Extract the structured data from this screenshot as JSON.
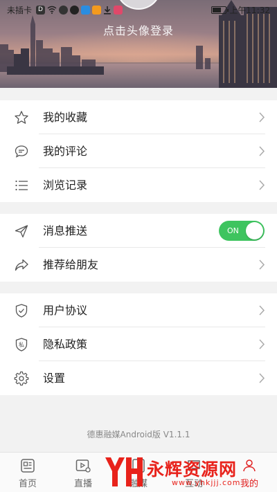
{
  "status_bar": {
    "carrier": "未插卡",
    "time": "上午11:32"
  },
  "header": {
    "login_prompt": "点击头像登录"
  },
  "sections": [
    {
      "items": [
        {
          "label": "我的收藏",
          "icon": "star-icon"
        },
        {
          "label": "我的评论",
          "icon": "comment-icon"
        },
        {
          "label": "浏览记录",
          "icon": "list-icon"
        }
      ]
    },
    {
      "items": [
        {
          "label": "消息推送",
          "icon": "send-icon",
          "toggle": "ON"
        },
        {
          "label": "推荐给朋友",
          "icon": "share-icon"
        }
      ]
    },
    {
      "items": [
        {
          "label": "用户协议",
          "icon": "shield-check-icon"
        },
        {
          "label": "隐私政策",
          "icon": "privacy-shield-icon",
          "icon_text": "私"
        },
        {
          "label": "设置",
          "icon": "gear-icon"
        }
      ]
    }
  ],
  "version": "德惠融媒Android版 V1.1.1",
  "tabs": [
    {
      "label": "首页",
      "icon": "news-icon"
    },
    {
      "label": "直播",
      "icon": "video-icon"
    },
    {
      "label": "融媒",
      "icon": "media-icon"
    },
    {
      "label": "互动",
      "icon": "chat-icon"
    },
    {
      "label": "我的",
      "icon": "user-icon",
      "active": true
    }
  ],
  "watermark": {
    "title": "永辉资源网",
    "url": "www.yhkjjj.com"
  },
  "colors": {
    "accent": "#3ec45f",
    "tab_active": "#e02020",
    "watermark": "#e8221b"
  }
}
